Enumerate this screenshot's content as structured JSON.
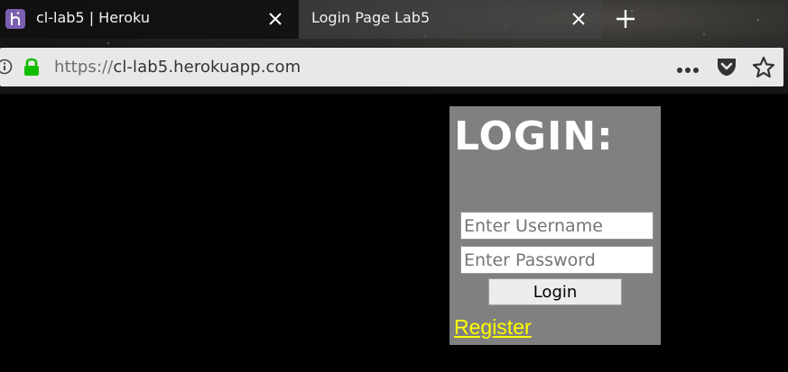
{
  "browser": {
    "tabs": [
      {
        "title": "cl-lab5 | Heroku",
        "favicon": "heroku-icon",
        "active": false
      },
      {
        "title": "Login Page Lab5",
        "active": true
      }
    ],
    "url": {
      "scheme": "https://",
      "host": "cl-lab5.herokuapp.com"
    }
  },
  "page": {
    "login_title": "LOGIN:",
    "username": {
      "value": "",
      "placeholder": "Enter Username"
    },
    "password": {
      "value": "",
      "placeholder": "Enter Password"
    },
    "login_button": "Login",
    "register_link": "Register",
    "colors": {
      "page_background": "#000000",
      "panel_background": "#808080",
      "link": "#ffff00"
    }
  }
}
